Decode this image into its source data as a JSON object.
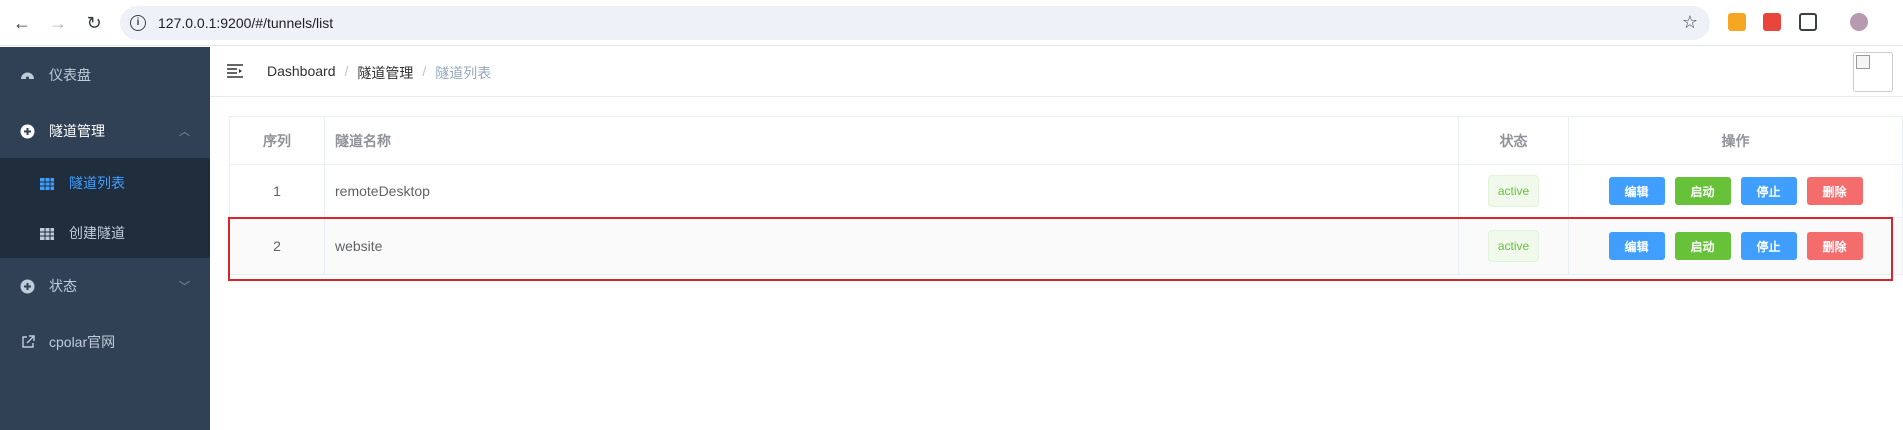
{
  "browser": {
    "url": "127.0.0.1:9200/#/tunnels/list"
  },
  "sidebar": {
    "items": [
      {
        "label": "仪表盘"
      },
      {
        "label": "隧道管理"
      },
      {
        "label": "状态"
      },
      {
        "label": "cpolar官网"
      }
    ],
    "submenu": [
      {
        "label": "隧道列表"
      },
      {
        "label": "创建隧道"
      }
    ]
  },
  "breadcrumb": {
    "items": [
      "Dashboard",
      "隧道管理",
      "隧道列表"
    ],
    "separator": "/"
  },
  "table": {
    "headers": [
      "序列",
      "隧道名称",
      "状态",
      "操作"
    ],
    "rows": [
      {
        "index": "1",
        "name": "remoteDesktop",
        "status": "active"
      },
      {
        "index": "2",
        "name": "website",
        "status": "active"
      }
    ],
    "actions": [
      "编辑",
      "启动",
      "停止",
      "删除"
    ]
  },
  "colors": {
    "sidebar_bg": "#304156",
    "submenu_bg": "#1f2d3d",
    "active": "#409eff",
    "success": "#67c23a",
    "danger": "#f56c6c",
    "highlight_border": "#d9232d"
  }
}
